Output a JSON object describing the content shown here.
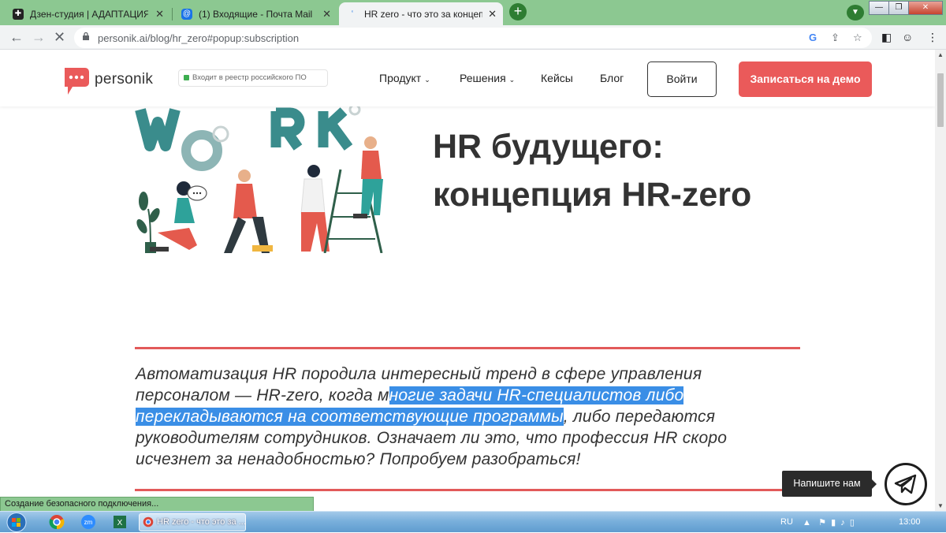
{
  "browser": {
    "tabs": [
      {
        "title": "Дзен-студия | АДАПТАЦИЯ ЛЮДЕЙ",
        "active": false
      },
      {
        "title": "(1) Входящие - Почта Mail",
        "active": false
      },
      {
        "title": "HR zero - что это за концепция",
        "active": true
      }
    ],
    "new_tab": "+",
    "url": "personik.ai/blog/hr_zero#popup:subscription",
    "status": "Создание безопасного подключения..."
  },
  "site": {
    "logo_text": "personik",
    "registry_badge": "Входит в реестр российского ПО",
    "nav": [
      {
        "label": "Продукт",
        "dropdown": true
      },
      {
        "label": "Решения",
        "dropdown": true
      },
      {
        "label": "Кейсы",
        "dropdown": false
      },
      {
        "label": "Блог",
        "dropdown": false
      }
    ],
    "login_label": "Войти",
    "demo_label": "Записаться на демо",
    "brand_color": "#ea5a5a"
  },
  "article": {
    "headline_line1": "HR будущего:",
    "headline_line2": "концепция HR-zero",
    "lead_before": "Автоматизация HR породила интересный тренд в сфере управления персоналом — HR-zero, когда м",
    "lead_highlight": "ногие задачи HR-специалистов либо перекладываются на соответствующие программы",
    "lead_after": ", либо передаются руководителям сотрудников. Означает ли это, что профессия HR скоро исчезнет за ненадобностью? Попробуем разобраться!"
  },
  "widget": {
    "tooltip": "Напишите нам",
    "icon": "telegram-icon"
  },
  "taskbar": {
    "task_label": "HR zero - что это за ...",
    "lang": "RU",
    "time": "13:00"
  }
}
